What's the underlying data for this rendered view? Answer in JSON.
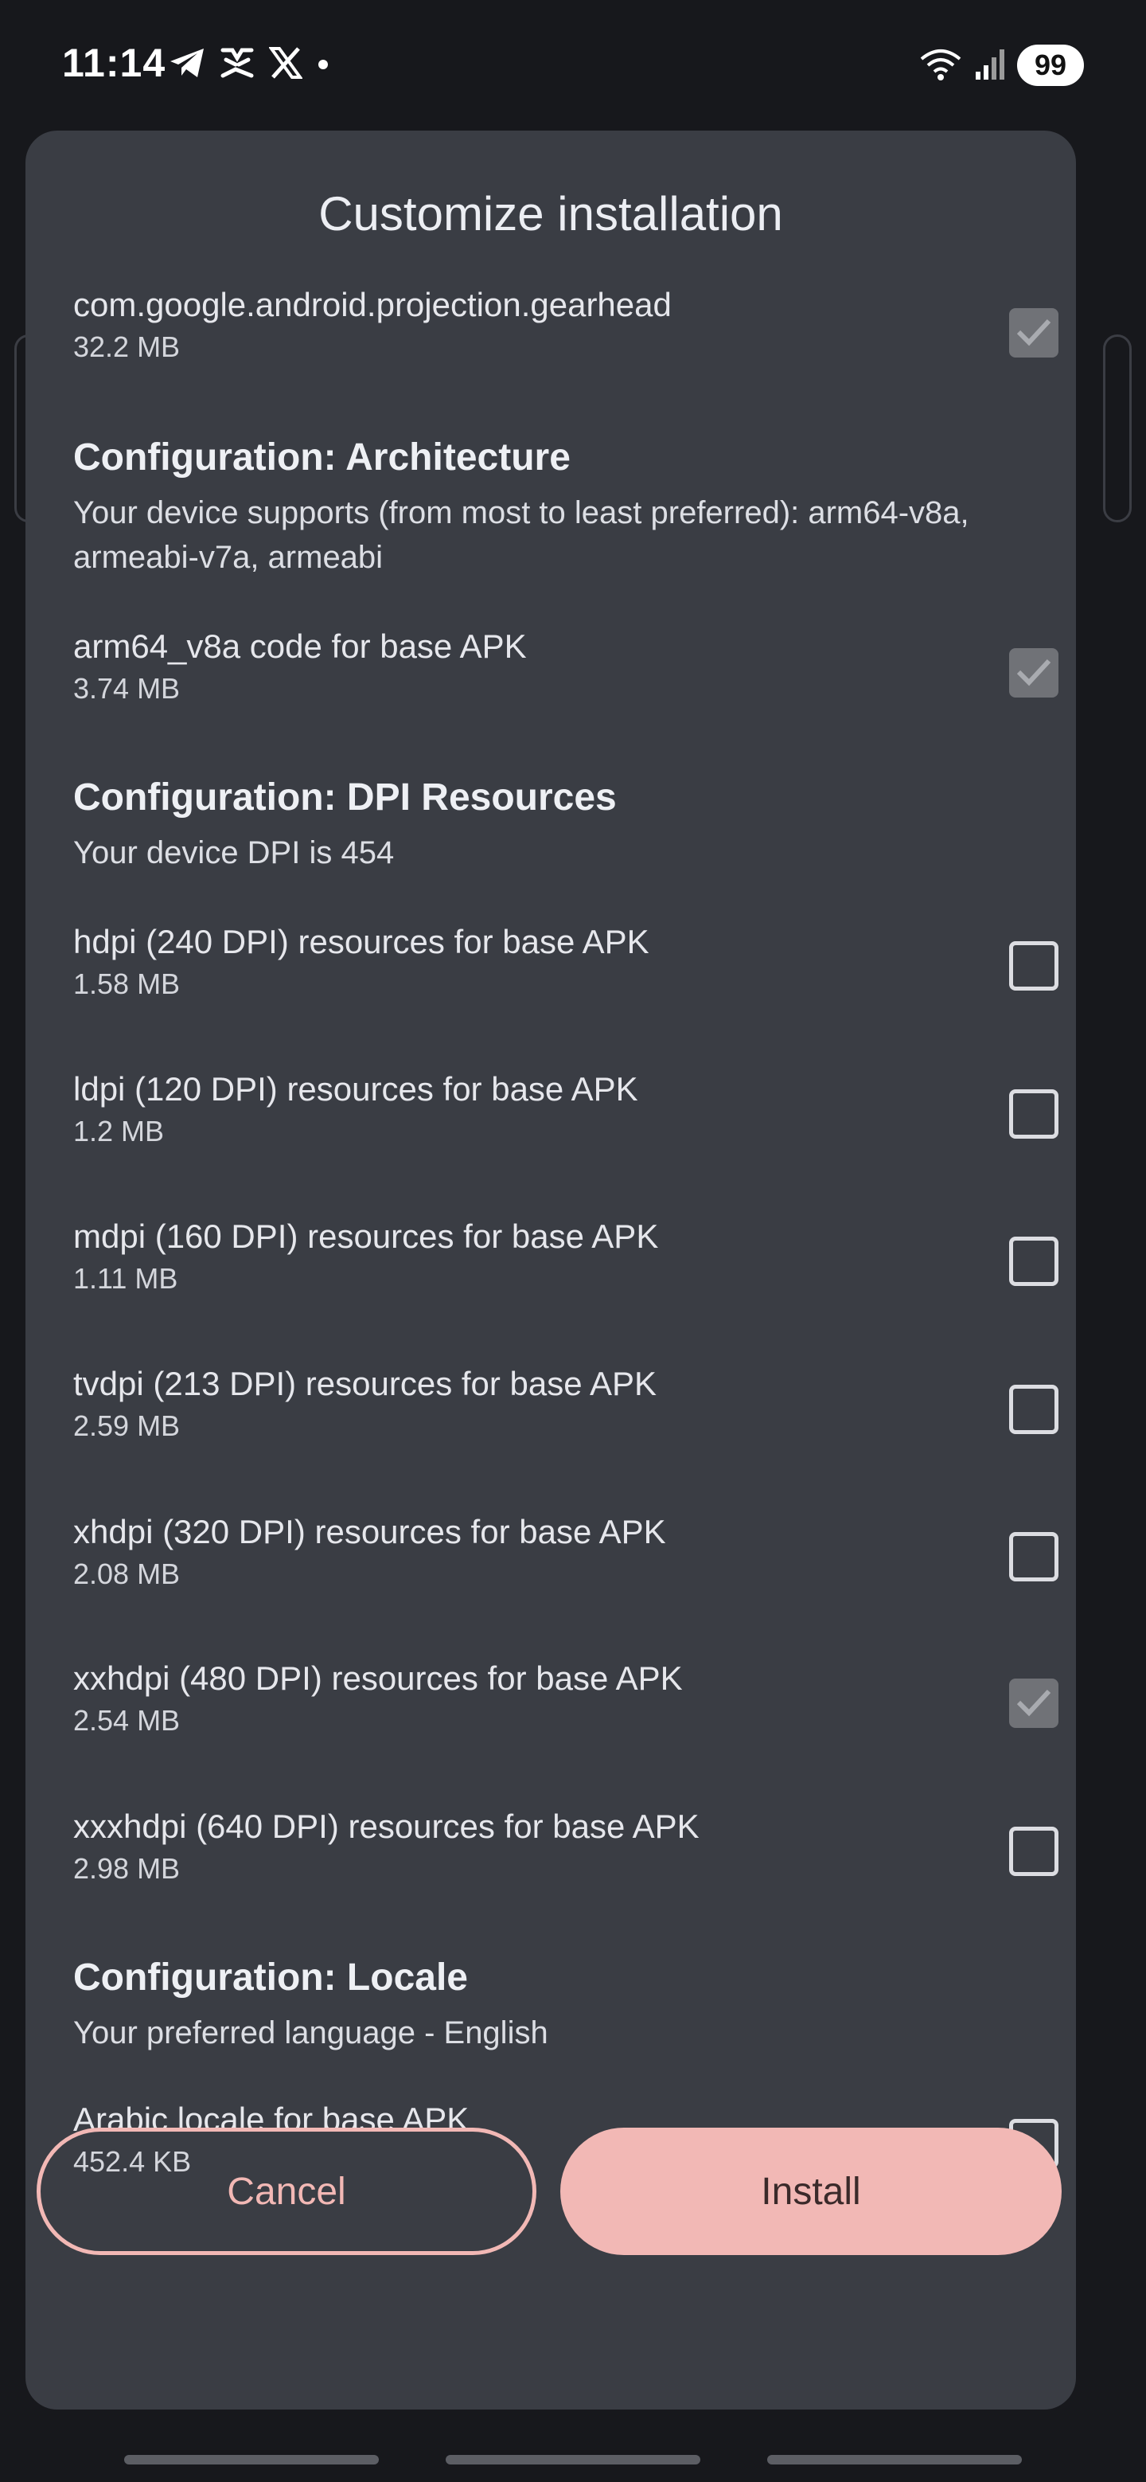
{
  "status_bar": {
    "time": "11:14",
    "battery": "99",
    "left_icons": [
      "telegram-icon",
      "app-notification-icon",
      "x-icon",
      "dot-icon"
    ],
    "right_icons": [
      "wifi-icon",
      "signal-icon"
    ]
  },
  "dialog": {
    "title": "Customize installation",
    "rows": [
      {
        "name": "com.google.android.projection.gearhead",
        "size": "32.2 MB",
        "checked": true
      },
      {
        "section_title": "Configuration: Architecture",
        "section_sub": "Your device supports (from most to least preferred): arm64-v8a, armeabi-v7a, armeabi"
      },
      {
        "name": "arm64_v8a code for base APK",
        "size": "3.74 MB",
        "checked": true
      },
      {
        "section_title": "Configuration: DPI Resources",
        "section_sub": "Your device DPI is 454"
      },
      {
        "name": "hdpi (240 DPI) resources for base APK",
        "size": "1.58 MB",
        "checked": false
      },
      {
        "name": "ldpi (120 DPI) resources for base APK",
        "size": "1.2 MB",
        "checked": false
      },
      {
        "name": "mdpi (160 DPI) resources for base APK",
        "size": "1.11 MB",
        "checked": false
      },
      {
        "name": "tvdpi (213 DPI) resources for base APK",
        "size": "2.59 MB",
        "checked": false
      },
      {
        "name": "xhdpi (320 DPI) resources for base APK",
        "size": "2.08 MB",
        "checked": false
      },
      {
        "name": "xxhdpi (480 DPI) resources for base APK",
        "size": "2.54 MB",
        "checked": true
      },
      {
        "name": "xxxhdpi (640 DPI) resources for base APK",
        "size": "2.98 MB",
        "checked": false
      },
      {
        "section_title": "Configuration: Locale",
        "section_sub": "Your preferred language - English"
      },
      {
        "name": "Arabic locale for base APK",
        "size": "452.4 KB",
        "checked": false
      }
    ],
    "cancel_label": "Cancel",
    "install_label": "Install"
  },
  "colors": {
    "dialog_bg": "#3a3d44",
    "accent": "#f2b8b5",
    "checkbox_checked": "#707277"
  }
}
